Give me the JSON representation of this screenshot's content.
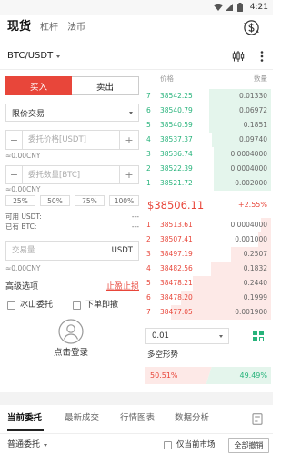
{
  "status_bar": {
    "time": "4:21",
    "icons": [
      "wifi-icon",
      "signal-icon",
      "battery-icon"
    ]
  },
  "header": {
    "tabs": [
      "现货",
      "杠杆",
      "法币"
    ],
    "exchange_icon": "currency-exchange-icon"
  },
  "pair": {
    "symbol": "BTC/USDT",
    "chart_icon": "candlestick-icon",
    "menu_icon": "more-vertical-icon"
  },
  "trade_form": {
    "buy_label": "买入",
    "sell_label": "卖出",
    "order_type": "限价交易",
    "minus": "−",
    "plus": "+",
    "price_placeholder": "委托价格[USDT]",
    "price_cny": "≈0.00CNY",
    "amount_placeholder": "委托数量[BTC]",
    "amount_cny": "≈0.00CNY",
    "percentages": [
      "25%",
      "50%",
      "75%",
      "100%"
    ],
    "available_label": "可用 USDT:",
    "available_value": "---",
    "holding_label": "已有 BTC:",
    "holding_value": "---",
    "volume_placeholder": "交易量",
    "volume_unit": "USDT",
    "volume_cny": "≈0.00CNY",
    "advanced_label": "高级选项",
    "tp_sl_label": "止盈止损",
    "options": [
      "冰山委托",
      "下单即撤"
    ],
    "login_icon": "user-avatar-icon",
    "login_label": "点击登录"
  },
  "order_book": {
    "price_header": "价格",
    "qty_header": "数量",
    "asks": [
      {
        "index": "7",
        "price": "38542.25",
        "qty": "0.01330",
        "depth": 0.49
      },
      {
        "index": "6",
        "price": "38540.79",
        "qty": "0.06972",
        "depth": 0.49
      },
      {
        "index": "5",
        "price": "38540.59",
        "qty": "0.1851",
        "depth": 0.49
      },
      {
        "index": "4",
        "price": "38537.37",
        "qty": "0.09740",
        "depth": 0.47
      },
      {
        "index": "3",
        "price": "38536.74",
        "qty": "0.0004000",
        "depth": 0.46
      },
      {
        "index": "2",
        "price": "38522.39",
        "qty": "0.0004000",
        "depth": 0.46
      },
      {
        "index": "1",
        "price": "38521.72",
        "qty": "0.002000",
        "depth": 0.46
      }
    ],
    "last_price": "$38506.11",
    "change": "+2.55%",
    "bids": [
      {
        "index": "1",
        "price": "38513.61",
        "qty": "0.0004000",
        "depth": 0.08
      },
      {
        "index": "2",
        "price": "38507.41",
        "qty": "0.001000",
        "depth": 0.1
      },
      {
        "index": "3",
        "price": "38497.19",
        "qty": "0.2507",
        "depth": 0.32
      },
      {
        "index": "4",
        "price": "38482.56",
        "qty": "0.1832",
        "depth": 0.48
      },
      {
        "index": "5",
        "price": "38478.21",
        "qty": "0.2440",
        "depth": 0.62
      },
      {
        "index": "6",
        "price": "38478.20",
        "qty": "0.1999",
        "depth": 0.72
      },
      {
        "index": "7",
        "price": "38477.05",
        "qty": "0.001900",
        "depth": 0.8
      }
    ],
    "precision": "0.01",
    "layout_icon": "grid-icon",
    "sentiment_label": "多空形势",
    "long_pct": "50.51%",
    "short_pct": "49.49%",
    "long_fraction": 0.5051
  },
  "bottom": {
    "tabs": [
      "当前委托",
      "最新成交",
      "行情图表",
      "数据分析"
    ],
    "tab_icon": "document-icon",
    "order_filter": "普通委托",
    "current_market_label": "仅当前市场",
    "cancel_all_label": "全部撤销"
  },
  "colors": {
    "red": "#e8463a",
    "green": "#27b37b",
    "red_bg": "#fde9e7",
    "green_bg": "#e4f5ec"
  }
}
